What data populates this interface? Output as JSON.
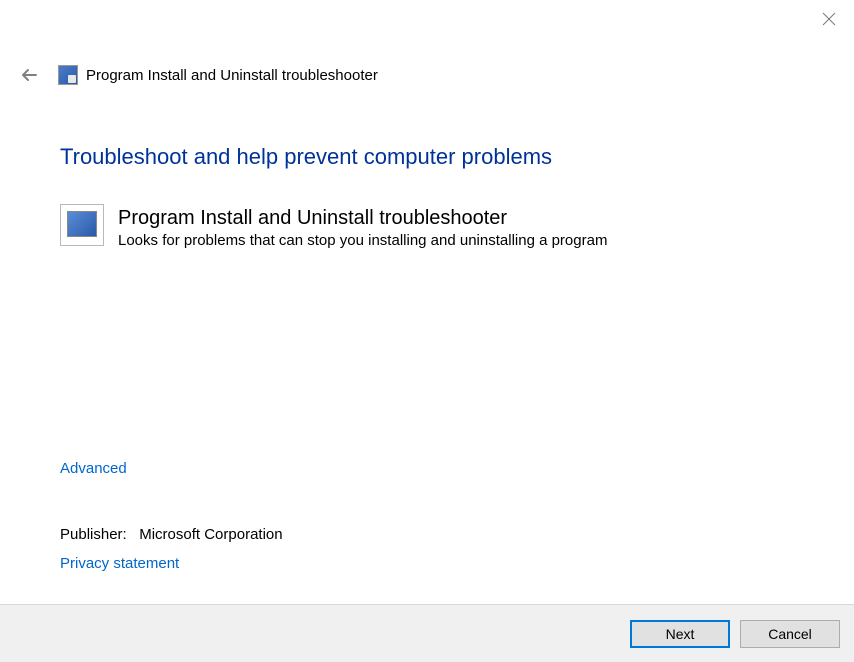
{
  "window": {
    "title": "Program Install and Uninstall troubleshooter"
  },
  "page": {
    "heading": "Troubleshoot and help prevent computer problems"
  },
  "troubleshooter": {
    "name": "Program Install and Uninstall troubleshooter",
    "description": "Looks for problems that can stop you installing and uninstalling a program"
  },
  "links": {
    "advanced": "Advanced",
    "privacy": "Privacy statement"
  },
  "publisher": {
    "label": "Publisher:",
    "value": "Microsoft Corporation"
  },
  "buttons": {
    "next": "Next",
    "cancel": "Cancel"
  }
}
